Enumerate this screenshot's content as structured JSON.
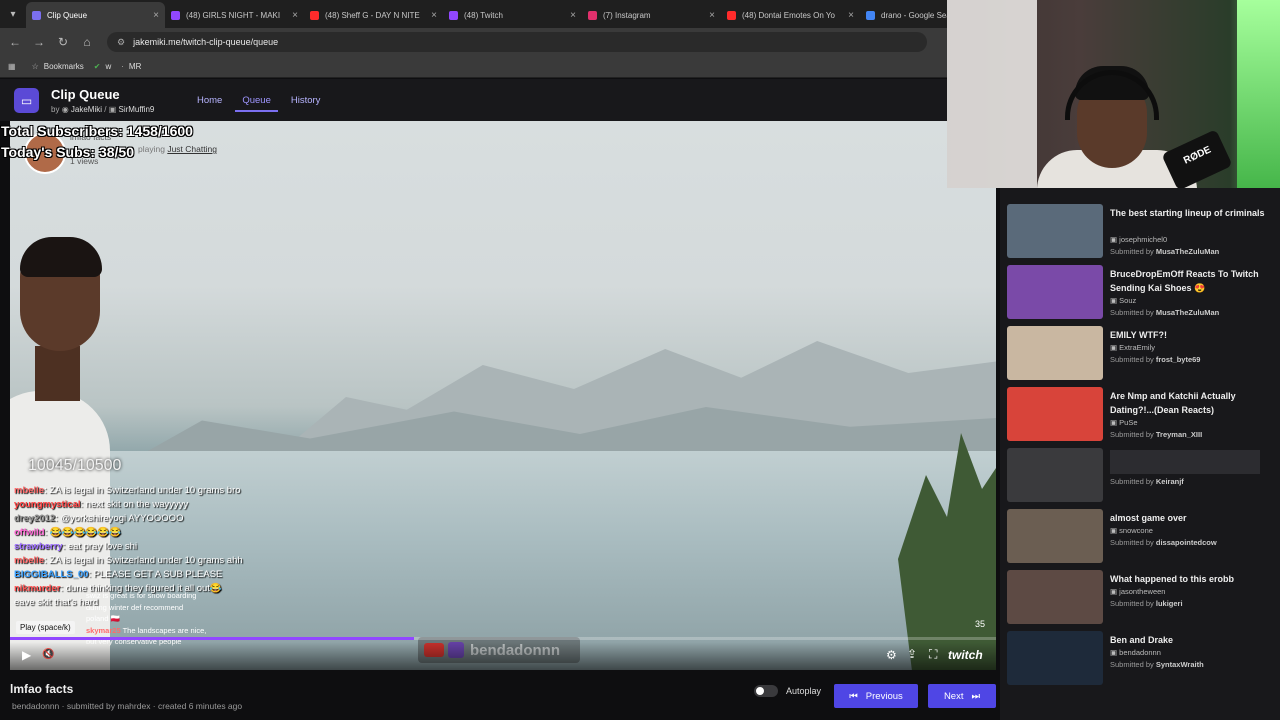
{
  "browser": {
    "tabs": [
      {
        "title": "Clip Queue",
        "color": "#7b6ff0",
        "active": true
      },
      {
        "title": "(48) GIRLS NIGHT - MAKI",
        "color": "#9147ff"
      },
      {
        "title": "(48) Sheff G - DAY N NITE",
        "color": "#ff2b2b"
      },
      {
        "title": "(48) Twitch",
        "color": "#9147ff"
      },
      {
        "title": "(7) Instagram",
        "color": "#e1306c"
      },
      {
        "title": "(48) Dontai Emotes On Yo",
        "color": "#ff2b2b"
      },
      {
        "title": "drano - Google Sea",
        "color": "#4285f4"
      }
    ],
    "url": "jakemiki.me/twitch-clip-queue/queue",
    "bookmarks": [
      "Bookmarks",
      "w",
      "MR"
    ]
  },
  "app": {
    "title": "Clip Queue",
    "by": "by",
    "author1": "JakeMiki",
    "author2": "SirMuffin9",
    "nav": [
      "Home",
      "Queue",
      "History"
    ],
    "active_nav": "Queue"
  },
  "overlay": {
    "total_subs": "Total Subscribers: 1458/1600",
    "today_subs": "Today's Subs: 38/50",
    "goal": "10045/10500"
  },
  "clip": {
    "channel": "lmfao facts",
    "playing": "playing",
    "category": "Just Chatting",
    "views": "1 views",
    "title": "lmfao facts",
    "meta": "bendadonnn · submitted by mahrdex · created 6 minutes ago",
    "counter": "35",
    "play_tip": "Play (space/k)",
    "watermark": "bendadonnn"
  },
  "chat": [
    {
      "user": "mbelle",
      "color": "#ff6666",
      "msg": ": ZA is legal in Switzerland under 10 grams bro"
    },
    {
      "user": "youngmystical",
      "color": "#ff4040",
      "msg": ": next skit on the wayyyyy"
    },
    {
      "user": "drey2012",
      "color": "#8f8f8f",
      "msg": ": @yorkshireyogi AYYOOOOO"
    },
    {
      "user": "offwild",
      "color": "#ff6ad5",
      "msg": ": 😂😂😂😂😂😂"
    },
    {
      "user": "strawberry",
      "color": "#9b6bff",
      "msg": ": eat pray love shi"
    },
    {
      "user": "mbelle",
      "color": "#ff6666",
      "msg": ": ZA is legal in Switzerland under 10 grams ahh"
    },
    {
      "user": "BIGGIBALLS_00",
      "color": "#3aa0ff",
      "msg": ": PLEASE GET A SUB PLEASE"
    },
    {
      "user": "nikmurder",
      "color": "#ff5050",
      "msg": ": dune thinking they figured it all out😂"
    },
    {
      "user": "",
      "color": "#ffffff",
      "msg": "eave skit that's hard"
    }
  ],
  "chat2": [
    {
      "user": "",
      "msg": "swiz is great is for snow boarding during winter def recommend"
    },
    {
      "user": "",
      "msg": "poland 🇵🇱"
    },
    {
      "user": "skymar25",
      "msg": "The landscapes are nice, but very conservative people"
    }
  ],
  "player_controls": {
    "autoplay": "Autoplay",
    "previous": "Previous",
    "next": "Next",
    "progress": 0.41
  },
  "queue": [
    {
      "title": "The best starting lineup of criminals",
      "channel": "josephmichel0",
      "submitted": "Submitted by",
      "by": "MusaTheZuluMan",
      "thumb": "#5a6a7a"
    },
    {
      "title": "BruceDropEmOff Reacts To Twitch Sending Kai Shoes 😍",
      "channel": "Souz",
      "submitted": "Submitted by",
      "by": "MusaTheZuluMan",
      "thumb": "#7a4aa8"
    },
    {
      "title": "EMILY WTF?!",
      "channel": "ExtraEmily",
      "submitted": "Submitted by",
      "by": "frost_byte69",
      "thumb": "#c9b7a1"
    },
    {
      "title": "Are Nmp and Katchii Actually Dating?!...(Dean Reacts)",
      "channel": "PuSe",
      "submitted": "Submitted by",
      "by": "Treyman_XIII",
      "thumb": "#d8443a"
    },
    {
      "title": "",
      "channel": "",
      "submitted": "Submitted by",
      "by": "Keiranjf",
      "thumb": "#3a3a3d"
    },
    {
      "title": "almost game over",
      "channel": "snowcone",
      "submitted": "Submitted by",
      "by": "dissapointedcow",
      "thumb": "#6b5e52"
    },
    {
      "title": "What happened to this erobb",
      "channel": "jasontheween",
      "submitted": "Submitted by",
      "by": "lukigeri",
      "thumb": "#5d4a44"
    },
    {
      "title": "Ben and Drake",
      "channel": "bendadonnn",
      "submitted": "Submitted by",
      "by": "SyntaxWraith",
      "thumb": "#1e2a3a"
    }
  ],
  "webcam": {
    "brand": "RØDE"
  }
}
